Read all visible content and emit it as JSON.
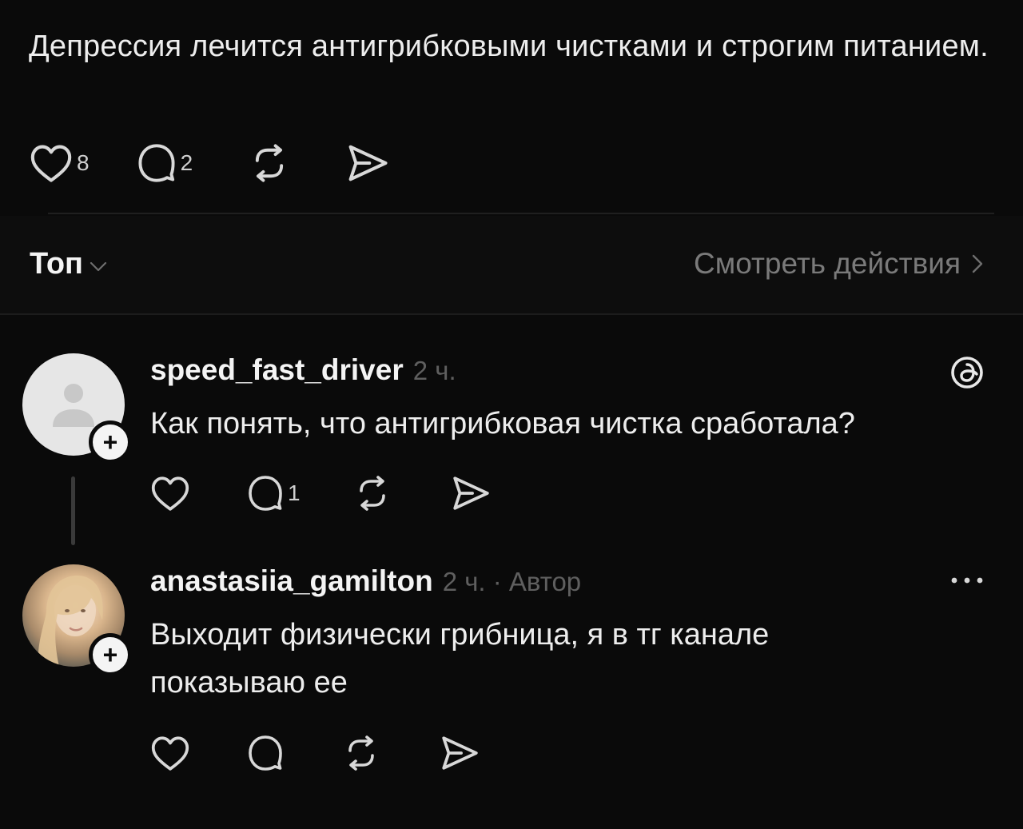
{
  "post": {
    "text": "Депрессия лечится антигрибковыми чистками и строгим питанием.",
    "like_count": "8",
    "comment_count": "2"
  },
  "sort": {
    "label": "Топ",
    "view_activity": "Смотреть действия"
  },
  "comments": [
    {
      "username": "speed_fast_driver",
      "time": "2 ч.",
      "text": "Как понять, что антигрибковая чистка сработала?",
      "like_count": "",
      "comment_count": "1",
      "badge_icon": "threads-icon"
    },
    {
      "username": "anastasiia_gamilton",
      "time": "2 ч. · Автор",
      "text": "Выходит физически грибница, я в тг канале показываю ее",
      "like_count": "",
      "comment_count": "",
      "menu_icon": "more-icon"
    }
  ],
  "colors": {
    "background": "#0a0a0a",
    "text": "#ededed",
    "muted": "#7a7a7a"
  }
}
